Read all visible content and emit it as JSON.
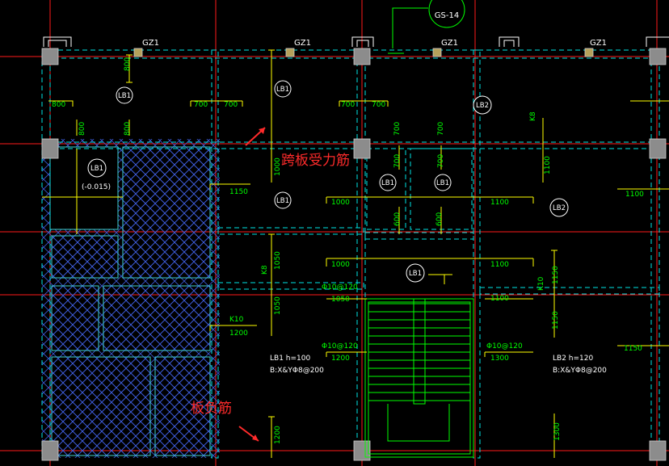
{
  "drawing": {
    "column_labels": [
      "GZ1",
      "GZ1",
      "GZ1",
      "GZ1"
    ],
    "gs_label": "GS-14",
    "slab_tags": [
      "LB1",
      "LB1",
      "LB1",
      "LB1",
      "LB1",
      "LB2",
      "LB2",
      "LB1",
      "LB1"
    ],
    "slab_tag_sub": "(-0.015)",
    "dimensions": {
      "d800a": "800",
      "d700a": "700",
      "d700b": "700",
      "d700c": "700",
      "d700d": "700",
      "d1150a": "1150",
      "d1000a": "1000",
      "d1100a": "1100",
      "d1100b": "1100",
      "d1000b": "1000",
      "d1100c": "1100",
      "d1050a": "1050",
      "d1100d": "1100",
      "d1200a": "1200",
      "d1200b": "1200",
      "d1300a": "1300",
      "d1150b": "1150",
      "v800a": "800",
      "v800b": "800",
      "v800c": "800",
      "v700a": "700",
      "v700b": "700",
      "v700c": "700",
      "v700d": "700",
      "v600a": "600",
      "v600b": "600",
      "v1000": "1000",
      "v1050a": "1050",
      "v1050b": "1050",
      "v1100": "1100",
      "v1150a": "1150",
      "v1150b": "1150",
      "v1200": "1200",
      "v1300": "1300"
    },
    "rebar_marks": {
      "k10a": "K10",
      "k10b": "K10",
      "k8a": "K8",
      "k8b": "K8",
      "phi120a": "Φ10@120",
      "phi120b": "Φ10@120",
      "phi120c": "Φ10@120"
    },
    "slab_notes": {
      "lb1_h": "LB1  h=100",
      "lb1_b": "B:X&YΦ8@200",
      "lb2_h": "LB2  h=120",
      "lb2_b": "B:X&YΦ8@200"
    },
    "annotations": {
      "span_rebar": "跨板受力筋",
      "neg_rebar": "板负筋"
    }
  },
  "colors": {
    "background": "#000000",
    "grid": "#ff1a1a",
    "beam": "#00e5e5",
    "rebar": "#ffff00",
    "dimension": "#00ff00",
    "annotation": "#ff2b2b",
    "column": "#9a9a9a"
  }
}
